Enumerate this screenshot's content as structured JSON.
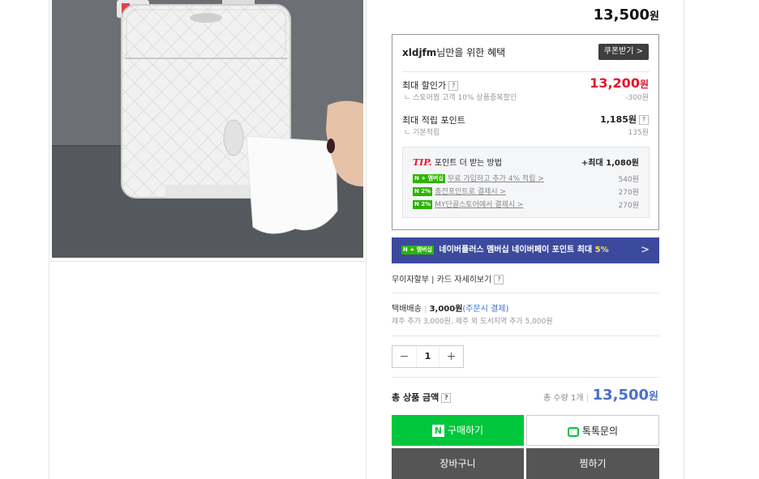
{
  "price_top": {
    "amount": "13,500",
    "unit": "원"
  },
  "benefit": {
    "user": "xldjfm",
    "title_rest": "님만을 위한 혜택",
    "coupon_button": "쿠폰받기 >",
    "max_discount_label": "최대 할인가",
    "max_discount_price": "13,200",
    "max_discount_unit": "원",
    "max_discount_sub": "ㄴ 스토어찜 고객 10% 상품중복할인",
    "max_discount_sub_value": "-300원",
    "max_point_label": "최대 적립 포인트",
    "max_point_value": "1,185원",
    "max_point_sub": "ㄴ 기본적립",
    "max_point_sub_value": "135원",
    "tip_prefix": "TIP.",
    "tip_title": " 포인트 더 받는 방법",
    "tip_max": "+최대 1,080원",
    "tip_items": [
      {
        "badge": "N + 멤버십",
        "text": "무료 가입하고 추가 4% 적립 >",
        "points": "540원"
      },
      {
        "badge": "N 2%",
        "text": "충전포인트로 결제시 >",
        "points": "270원"
      },
      {
        "badge": "N 2%",
        "text": "MY단골스토어에서 결제시 >",
        "points": "270원"
      }
    ]
  },
  "banner": {
    "badge": "N + 멤버십",
    "text": "네이버플러스 멤버십 네이버페이 포인트 최대 ",
    "pct": "5%",
    "chevron": ">"
  },
  "card": {
    "text": "무이자할부 | 카드 자세히보기"
  },
  "shipping": {
    "label": "택배배송",
    "fee": "3,000원",
    "note": "(주문시 결제)",
    "sub": "제주 추가 3,000원, 제주 외 도서지역 추가 5,000원"
  },
  "quantity": {
    "minus": "−",
    "value": "1",
    "plus": "+"
  },
  "total": {
    "label": "총 상품 금액",
    "count": "총 수량 1개",
    "amount": "13,500",
    "unit": "원"
  },
  "buttons": {
    "buy": "구매하기",
    "talk": "톡톡문의",
    "cart": "장바구니",
    "wish": "찜하기"
  },
  "colors": {
    "naver_green": "#00c73c",
    "discount_red": "#e8112d",
    "total_blue": "#4e6fc6",
    "banner_navy": "#3c4a9e"
  }
}
